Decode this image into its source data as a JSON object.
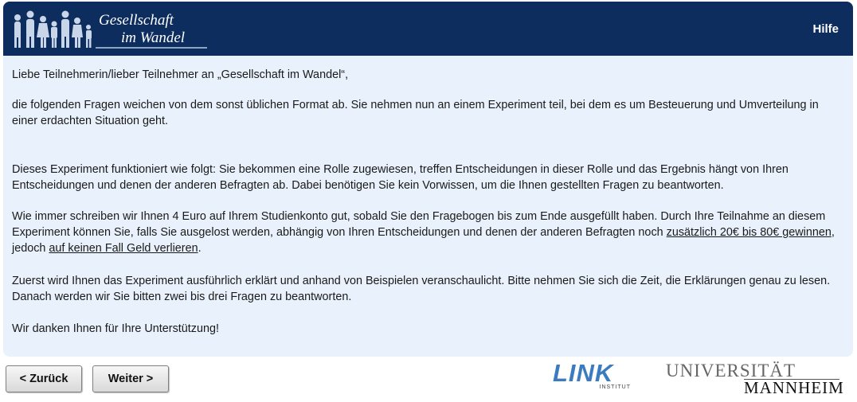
{
  "header": {
    "logo_line1": "Gesellschaft",
    "logo_line2": "im Wandel",
    "help_label": "Hilfe",
    "background_color": "#0d2d5e"
  },
  "content": {
    "background_color": "#e9f2fc",
    "greeting": "Liebe Teilnehmerin/lieber Teilnehmer an „Gesellschaft im Wandel“,",
    "para1": "die folgenden Fragen weichen von dem sonst üblichen Format ab. Sie nehmen nun an einem Experiment teil, bei dem es um Besteuerung und Umverteilung in einer erdachten Situation geht.",
    "para2": "Dieses Experiment funktioniert wie folgt: Sie bekommen eine Rolle zugewiesen, treffen Entscheidungen in dieser Rolle und das Ergebnis hängt von Ihren Entscheidungen und denen der anderen Befragten ab. Dabei benötigen Sie kein Vorwissen, um die Ihnen gestellten Fragen zu beantworten.",
    "para3_part1": "Wie immer schreiben wir Ihnen 4 Euro auf Ihrem Studienkonto gut, sobald Sie den Fragebogen bis zum Ende ausgefüllt haben. Durch Ihre Teilnahme an diesem Experiment können Sie, falls Sie ausgelost werden, abhängig von Ihren Entscheidungen und denen der anderen Befragten noch ",
    "para3_link1": "zusätzlich 20€ bis 80€ gewinnen",
    "para3_part2": ", jedoch ",
    "para3_link2": "auf keinen Fall Geld verlieren",
    "para3_part3": ".",
    "para4": "Zuerst wird Ihnen das Experiment ausführlich erklärt und anhand von Beispielen veranschaulicht. Bitte nehmen Sie sich die Zeit, die Erklärungen genau zu lesen. Danach werden wir Sie bitten zwei bis drei Fragen zu beantworten.",
    "para5": "Wir danken Ihnen für Ihre Unterstützung!"
  },
  "footer": {
    "back_label": "< Zurück",
    "next_label": "Weiter >",
    "link_logo_text": "LINK",
    "link_logo_sub": "INSTITUT",
    "uni_logo_line1": "UNIVERSITÄT",
    "uni_logo_line2": "MANNHEIM",
    "link_logo_color": "#3b7bc0"
  }
}
